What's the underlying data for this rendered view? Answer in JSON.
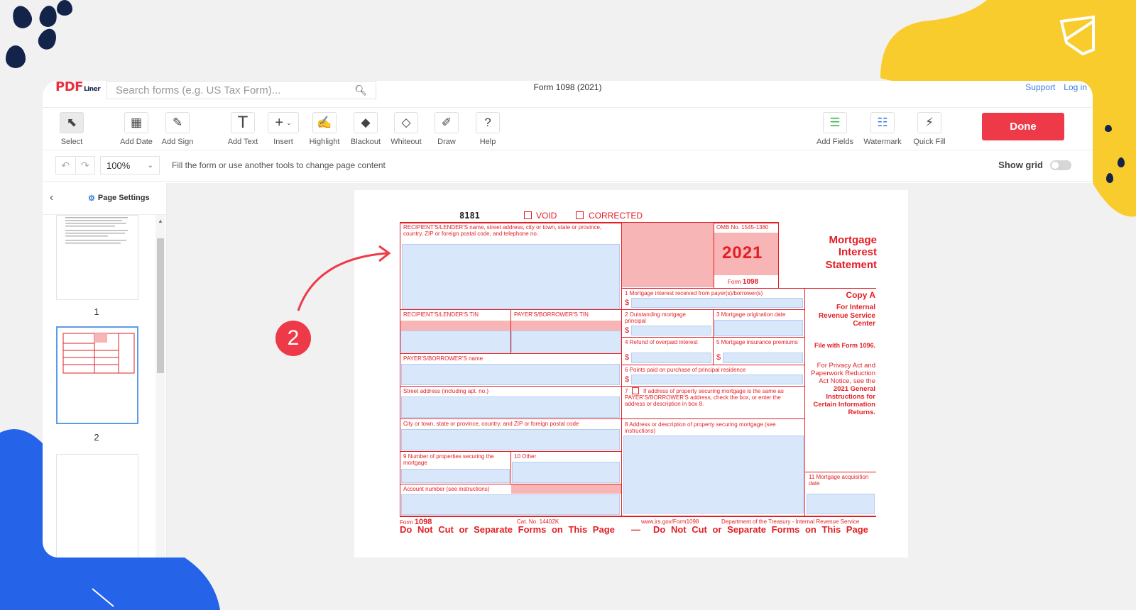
{
  "app": {
    "logo": "PDF",
    "logo_sub": "Liner",
    "search_placeholder": "Search forms (e.g. US Tax Form)...",
    "document_title": "Form 1098 (2021)",
    "links": [
      "Support",
      "Log in"
    ]
  },
  "toolbar": {
    "tools": [
      {
        "label": "Select",
        "icon": "cursor-icon"
      },
      {
        "label": "Add Date",
        "icon": "calendar-icon"
      },
      {
        "label": "Add Sign",
        "icon": "pen-icon"
      },
      {
        "label": "Add Text",
        "icon": "text-icon"
      },
      {
        "label": "Insert",
        "icon": "plus-icon"
      },
      {
        "label": "Highlight",
        "icon": "highlight-icon"
      },
      {
        "label": "Blackout",
        "icon": "blackout-icon"
      },
      {
        "label": "Whiteout",
        "icon": "whiteout-icon"
      },
      {
        "label": "Draw",
        "icon": "brush-icon"
      },
      {
        "label": "Help",
        "icon": "question-icon"
      }
    ],
    "right_tools": [
      {
        "label": "Add Fields",
        "icon": "fields-icon"
      },
      {
        "label": "Watermark",
        "icon": "watermark-icon"
      },
      {
        "label": "Quick Fill",
        "icon": "lightning-icon"
      }
    ],
    "done_label": "Done"
  },
  "subbar": {
    "zoom": "100%",
    "hint": "Fill the form or use another tools to change page content",
    "show_grid_label": "Show grid",
    "show_grid": false
  },
  "sidebar": {
    "title": "Page Settings",
    "pages": [
      "1",
      "2"
    ]
  },
  "annotation": {
    "step": "2",
    "color": "#ee3a48"
  },
  "form": {
    "code": "8181",
    "void": "VOID",
    "corrected": "CORRECTED",
    "recipient_label": "RECIPIENT'S/LENDER'S name, street address, city or town, state or province, country, ZIP or foreign postal code, and telephone no.",
    "omb": "OMB No. 1545-1380",
    "year": "2021",
    "form_label": "Form",
    "form_number": "1098",
    "title": "Mortgage Interest Statement",
    "recipient_tin": "RECIPIENT'S/LENDER'S TIN",
    "payer_tin": "PAYER'S/BORROWER'S TIN",
    "payer_name": "PAYER'S/BORROWER'S name",
    "street": "Street address (including apt. no.)",
    "city": "City or town, state or province, country, and ZIP or foreign postal code",
    "box9": "9 Number of properties securing the mortgage",
    "box10": "10 Other",
    "account": "Account number (see instructions)",
    "box1": "1 Mortgage interest received from payer(s)/borrower(s)",
    "box2": "2 Outstanding mortgage principal",
    "box3": "3 Mortgage origination date",
    "box4": "4 Refund of overpaid interest",
    "box5": "5 Mortgage insurance premiums",
    "box6": "6 Points paid on purchase of principal residence",
    "box7": "If address of property securing mortgage is the same as PAYER'S/BORROWER'S address, check the box, or enter the address or description in box 8.",
    "box7_num": "7",
    "box8": "8 Address or description of property securing mortgage (see instructions)",
    "box11": "11 Mortgage acquisition date",
    "dollar": "$",
    "copy_a": "Copy A",
    "for_irs": "For Internal Revenue Service Center",
    "file_with": "File with Form 1096.",
    "privacy": "For Privacy Act and Paperwork Reduction Act Notice, see the",
    "privacy_bold": "2021 General Instructions for Certain Information Returns.",
    "footer_form": "Form",
    "footer_num": "1098",
    "cat": "Cat. No. 14402K",
    "url": "www.irs.gov/Form1098",
    "dept": "Department of the Treasury - Internal Revenue Service",
    "do_not_cut": "Do Not Cut or Separate Forms on This Page",
    "dash": "—"
  }
}
